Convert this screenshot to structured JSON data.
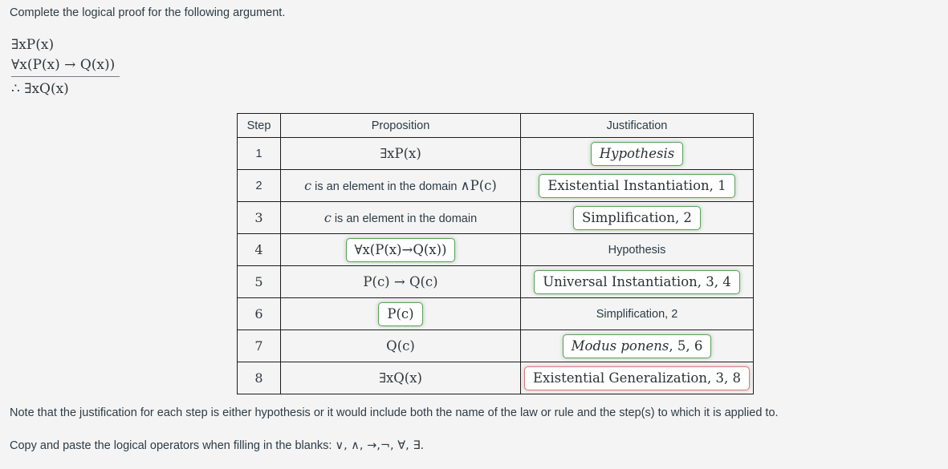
{
  "prompt": "Complete the logical proof for the following argument.",
  "argument": {
    "premise_1": "∃xP(x)",
    "premise_2": "∀x(P(x) → Q(x))",
    "conclusion": "∴ ∃xQ(x)"
  },
  "table": {
    "headers": {
      "step": "Step",
      "proposition": "Proposition",
      "justification": "Justification"
    },
    "rows": [
      {
        "step": "1",
        "proposition": "∃xP(x)",
        "proposition_boxed": false,
        "justification": "Hypothesis",
        "justification_boxed": true,
        "justification_status": "correct"
      },
      {
        "step": "2",
        "proposition_var": "c",
        "proposition_text": " is an element in the domain ",
        "proposition_math": "∧P(c)",
        "proposition": "c is an element in the domain ∧P(c)",
        "proposition_boxed": false,
        "justification": "Existential Instantiation, 1",
        "justification_boxed": true,
        "justification_status": "correct"
      },
      {
        "step": "3",
        "proposition_var": "c",
        "proposition_text": " is an element in the domain",
        "proposition_math": "",
        "proposition": "c is an element in the domain",
        "proposition_boxed": false,
        "justification": "Simplification, 2",
        "justification_boxed": true,
        "justification_status": "correct"
      },
      {
        "step": "4",
        "proposition": "∀x(P(x)→Q(x))",
        "proposition_boxed": true,
        "proposition_status": "correct",
        "justification": "Hypothesis",
        "justification_boxed": false
      },
      {
        "step": "5",
        "proposition": "P(c) → Q(c)",
        "proposition_boxed": false,
        "justification": "Universal Instantiation, 3, 4",
        "justification_boxed": true,
        "justification_status": "correct"
      },
      {
        "step": "6",
        "proposition": "P(c)",
        "proposition_boxed": true,
        "proposition_status": "correct",
        "justification": "Simplification, 2",
        "justification_boxed": false
      },
      {
        "step": "7",
        "proposition": "Q(c)",
        "proposition_boxed": false,
        "justification_italic": "Modus ponens",
        "justification_rest": ", 5, 6",
        "justification": "Modus ponens, 5, 6",
        "justification_boxed": true,
        "justification_status": "correct"
      },
      {
        "step": "8",
        "proposition": "∃xQ(x)",
        "proposition_boxed": false,
        "justification": "Existential Generalization, 3, 8",
        "justification_boxed": true,
        "justification_status": "incorrect"
      }
    ]
  },
  "notes": {
    "line_1": "Note that the justification for each step is either hypothesis or it would include both the name of the law or rule and the step(s) to which it is applied to.",
    "line_2_prefix": "Copy and paste the logical operators when filling in the blanks: ",
    "operators": "∨, ∧, →,¬, ∀, ∃."
  },
  "colors": {
    "background": "#f4f4f4",
    "text": "#2d3b45",
    "correct_border": "#5c9e5c",
    "incorrect_border": "#cf7f7d"
  }
}
